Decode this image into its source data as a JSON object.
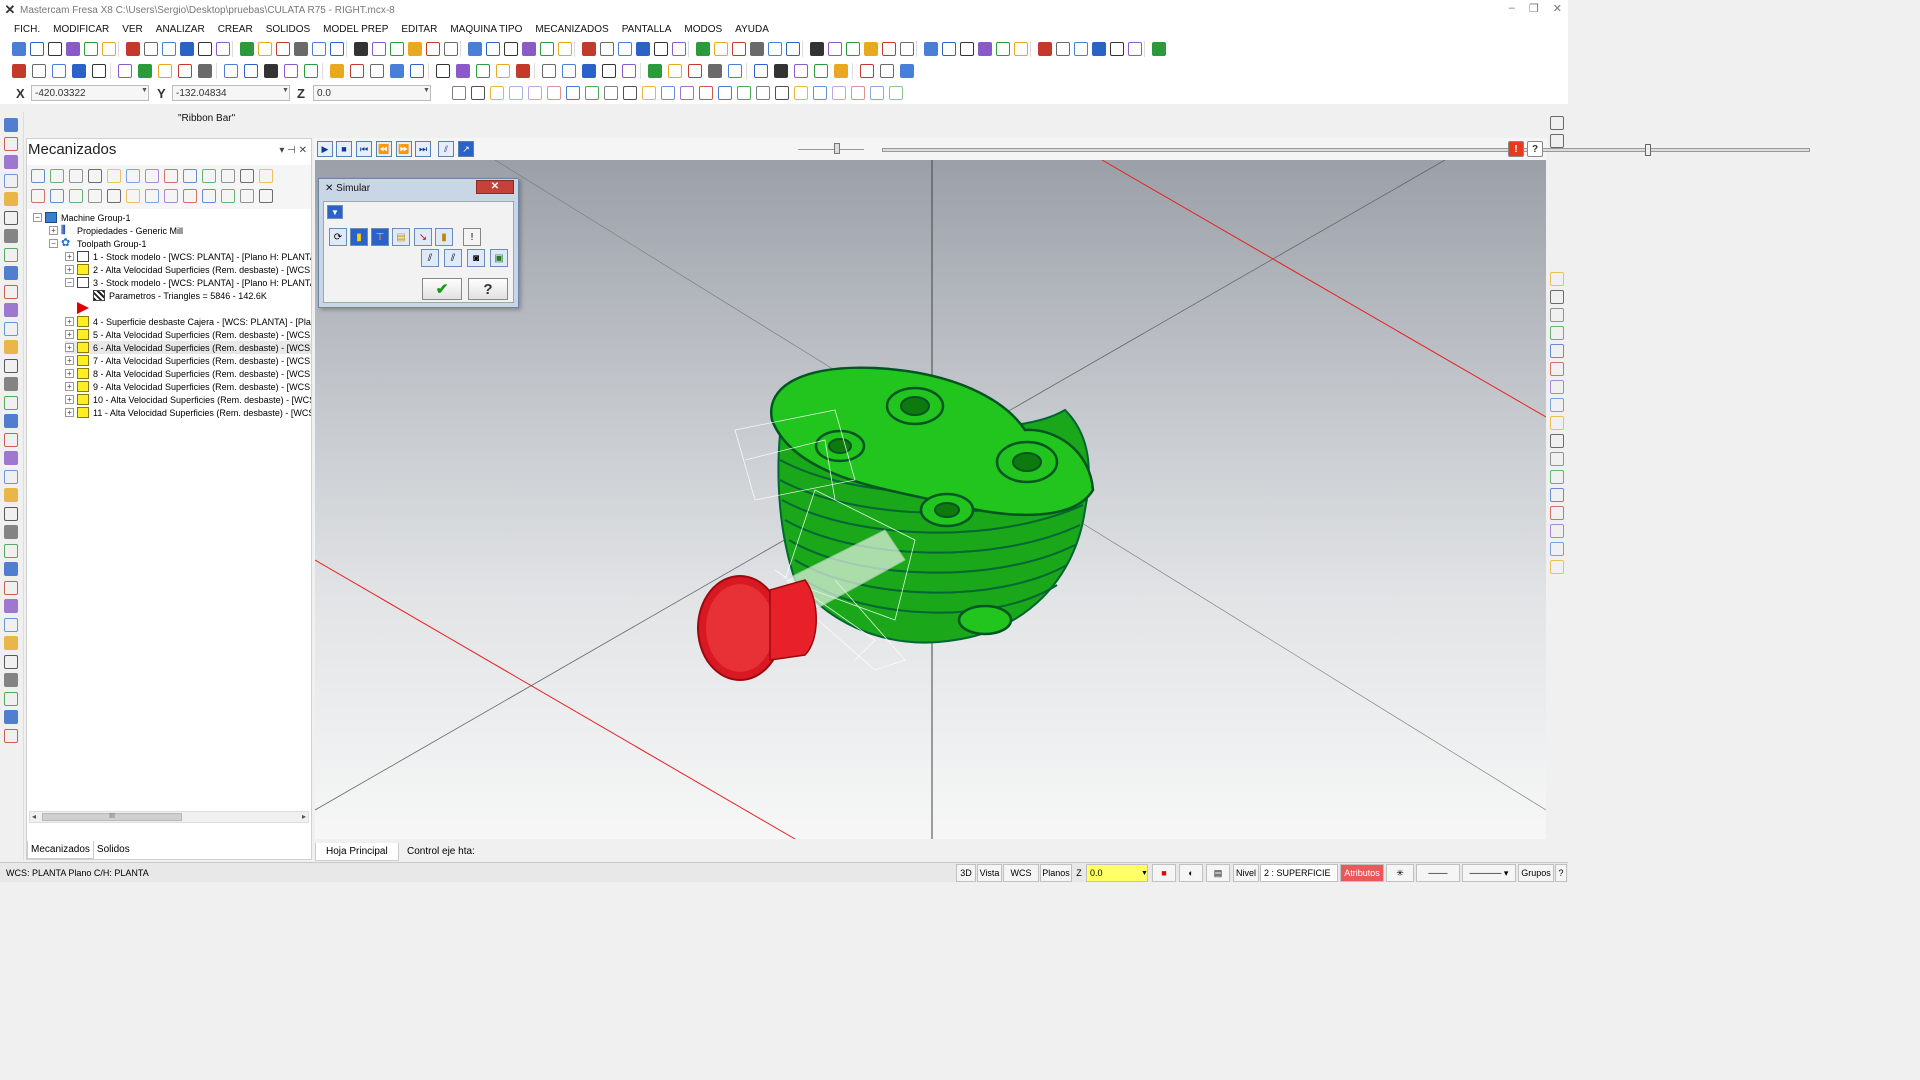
{
  "window": {
    "title": "Mastercam Fresa X8  C:\\Users\\Sergio\\Desktop\\pruebas\\CULATA R75 - RIGHT.mcx-8",
    "minimize": "–",
    "restore": "❐",
    "close": "✕"
  },
  "menu": [
    "FICH.",
    "MODIFICAR",
    "VER",
    "ANALIZAR",
    "CREAR",
    "SOLIDOS",
    "MODEL PREP",
    "EDITAR",
    "MAQUINA TIPO",
    "MECANIZADOS",
    "PANTALLA",
    "MODOS",
    "AYUDA"
  ],
  "coords": {
    "x_label": "X",
    "x_value": "-420.03322",
    "y_label": "Y",
    "y_value": "-132.04834",
    "z_label": "Z",
    "z_value": "0.0"
  },
  "ribbon_bar": {
    "label": "\"Ribbon Bar\""
  },
  "manager": {
    "title": "Mecanizados",
    "pin": "▾ ⊣ ✕",
    "tree": [
      {
        "label": "Machine Group-1",
        "type": "machine",
        "indent": 0,
        "exp": "−"
      },
      {
        "label": "Propiedades - Generic Mill",
        "type": "props",
        "indent": 1,
        "exp": "+"
      },
      {
        "label": "Toolpath Group-1",
        "type": "group",
        "indent": 1,
        "exp": "−"
      },
      {
        "label": "1 - Stock modelo - [WCS: PLANTA] - [Plano H: PLANTA]",
        "type": "stock",
        "indent": 2,
        "exp": "+"
      },
      {
        "label": "2 - Alta Velocidad Superficies (Rem. desbaste) - [WCS:",
        "type": "folder",
        "indent": 2,
        "exp": "+"
      },
      {
        "label": "3 - Stock modelo - [WCS: PLANTA] - [Plano H: PLANTA]",
        "type": "stock",
        "indent": 2,
        "exp": "−"
      },
      {
        "label": "Parametros - Triangles =  5846 - 142.6K",
        "type": "param",
        "indent": 3,
        "exp": ""
      },
      {
        "label": "",
        "type": "spacer",
        "indent": 0,
        "exp": ""
      },
      {
        "label": "4 - Superficie desbaste Cajera - [WCS: PLANTA] - [Plan",
        "type": "folder",
        "indent": 2,
        "exp": "+"
      },
      {
        "label": "5 - Alta Velocidad Superficies (Rem. desbaste) - [WCS:",
        "type": "folder",
        "indent": 2,
        "exp": "+"
      },
      {
        "label": "6 - Alta Velocidad Superficies (Rem. desbaste) - [WCS:",
        "type": "folder",
        "indent": 2,
        "exp": "+",
        "selected": true
      },
      {
        "label": "7 - Alta Velocidad Superficies (Rem. desbaste) - [WCS:",
        "type": "folder",
        "indent": 2,
        "exp": "+"
      },
      {
        "label": "8 - Alta Velocidad Superficies (Rem. desbaste) - [WCS:",
        "type": "folder",
        "indent": 2,
        "exp": "+"
      },
      {
        "label": "9 - Alta Velocidad Superficies (Rem. desbaste) - [WCS:",
        "type": "folder",
        "indent": 2,
        "exp": "+"
      },
      {
        "label": "10 - Alta Velocidad Superficies (Rem. desbaste) - [WCS",
        "type": "folder",
        "indent": 2,
        "exp": "+"
      },
      {
        "label": "11 - Alta Velocidad Superficies (Rem. desbaste) - [WCS",
        "type": "folder",
        "indent": 2,
        "exp": "+"
      }
    ],
    "scroll_thumb": "III",
    "tabs": [
      "Mecanizados",
      "Solidos"
    ]
  },
  "simulate_dialog": {
    "title": "Simular",
    "close": "✕",
    "ok": "✔",
    "help": "?"
  },
  "view_tabs": [
    "Hoja Principal",
    "Control eje hta:"
  ],
  "status": {
    "wcs": "WCS: PLANTA  Plano C/H: PLANTA",
    "view3d": "3D",
    "vista": "Vista",
    "wcs_btn": "WCS",
    "planos": "Planos",
    "z_label": "Z",
    "z_value": "0.0",
    "nivel_label": "Nivel",
    "nivel_value": "2 : SUPERFICIE",
    "atributos": "Atributos",
    "grupos": "Grupos",
    "help": "?"
  },
  "colors": {
    "part_green": "#22c41e",
    "tool_red": "#e8202a",
    "axis_red": "#e82020",
    "accent_blue": "#2a62c8"
  }
}
